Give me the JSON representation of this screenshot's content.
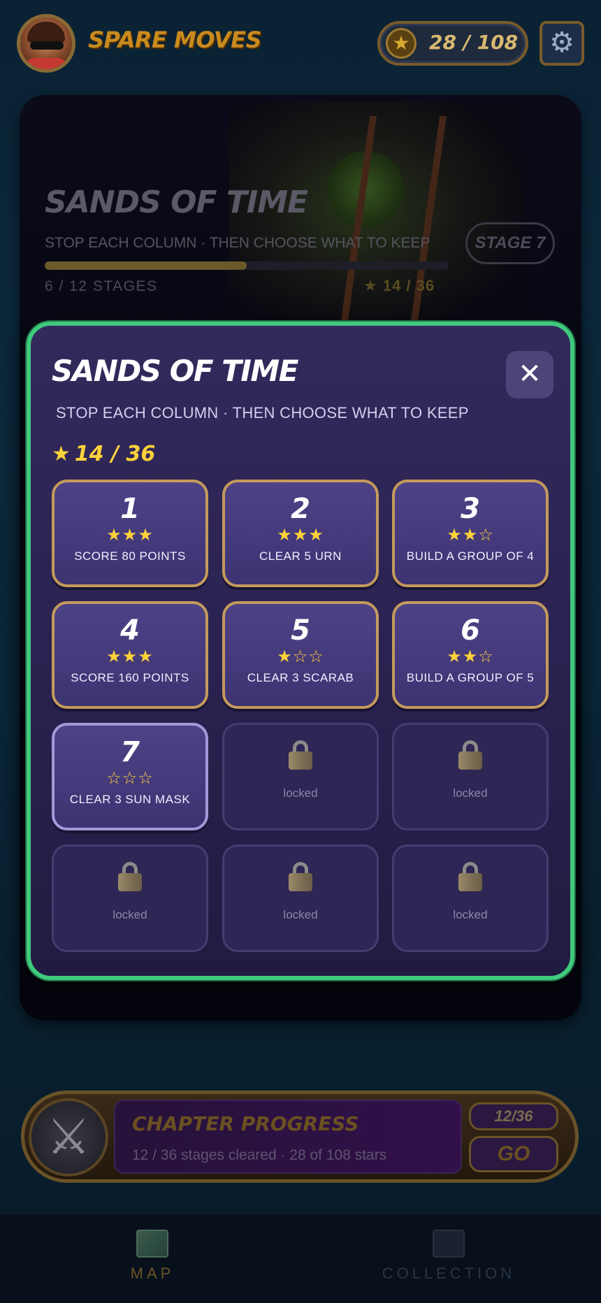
{
  "header": {
    "app_title": "SPARE MOVES",
    "star_count": "28 / 108",
    "avatar": "player-avatar",
    "settings_icon": "gear-icon"
  },
  "chapter": {
    "title": "SANDS OF TIME",
    "subtitle": "STOP EACH COLUMN · THEN CHOOSE WHAT TO KEEP",
    "progress_fraction": 0.5,
    "stages_text": "6 / 12 STAGES",
    "stars_text": "★ 14 / 36",
    "stage_button": "STAGE 7"
  },
  "modal": {
    "title": "SANDS OF TIME",
    "subtitle": "STOP EACH COLUMN · THEN CHOOSE WHAT TO KEEP",
    "stars_text": "14 / 36",
    "close_icon": "close-icon",
    "stages": [
      {
        "number": "1",
        "stars": "★★★",
        "goal": "SCORE 80 POINTS"
      },
      {
        "number": "2",
        "stars": "★★★",
        "goal": "CLEAR 5 URN"
      },
      {
        "number": "3",
        "stars": "★★☆",
        "goal": "BUILD A GROUP OF 4"
      },
      {
        "number": "4",
        "stars": "★★★",
        "goal": "SCORE 160 POINTS"
      },
      {
        "number": "5",
        "stars": "★☆☆",
        "goal": "CLEAR 3 SCARAB"
      },
      {
        "number": "6",
        "stars": "★★☆",
        "goal": "BUILD A GROUP OF 5"
      },
      {
        "number": "7",
        "stars": "☆☆☆",
        "goal": "CLEAR 3 SUN MASK"
      }
    ],
    "locked_label": "locked",
    "locked_count": 5
  },
  "progress_banner": {
    "title": "CHAPTER PROGRESS",
    "subtitle": "12 / 36 stages cleared · 28 of 108 stars",
    "count": "12/36",
    "go_label": "GO"
  },
  "nav": {
    "map_label": "MAP",
    "collection_label": "COLLECTION"
  },
  "colors": {
    "accent_green": "#3fca7c",
    "star_yellow": "#ffd23a",
    "tile_border_gold": "#c49a5c",
    "modal_bg": "#2a2250"
  }
}
